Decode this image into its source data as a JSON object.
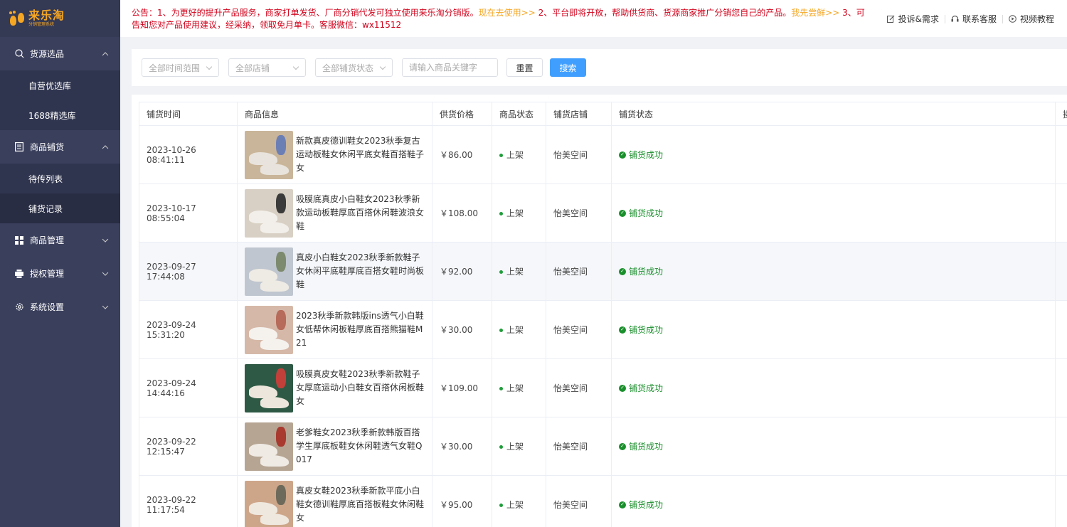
{
  "logo": {
    "title": "来乐淘",
    "subtitle": "分销管理系统",
    "brand_color": "#f5a623"
  },
  "sidebar": {
    "groups": [
      {
        "icon": "search-icon",
        "label": "货源选品",
        "expanded": true,
        "items": [
          "自营优选库",
          "1688精选库"
        ]
      },
      {
        "icon": "list-doc-icon",
        "label": "商品铺货",
        "expanded": true,
        "items": [
          "待传列表",
          "铺货记录"
        ],
        "active_item": "铺货记录"
      },
      {
        "icon": "grid-icon",
        "label": "商品管理",
        "expanded": false
      },
      {
        "icon": "printer-icon",
        "label": "授权管理",
        "expanded": false
      },
      {
        "icon": "gear-icon",
        "label": "系统设置",
        "expanded": false
      }
    ]
  },
  "notice": {
    "part1": "公告：1、为更好的提升产品服务，商家打单发货、厂商分销代发可独立使用来乐淘分销版。",
    "link1": "现在去使用>>",
    "part2": " 2、平台即将开放，帮助供货商、货源商家推广分销您自己的产品。",
    "link2": "我先尝鲜>>",
    "part3": " 3、可告知您对产品使用建议，经采纳，领取免月单卡。客服微信：wx11512"
  },
  "top_links": [
    "投诉&需求",
    "联系客服",
    "视频教程"
  ],
  "filters": {
    "time_range": "全部时间范围",
    "shop": "全部店铺",
    "status": "全部铺货状态",
    "keyword_placeholder": "请输入商品关键字",
    "reset": "重置",
    "search": "搜索"
  },
  "table": {
    "headers": [
      "铺货时间",
      "商品信息",
      "供货价格",
      "商品状态",
      "铺货店铺",
      "铺货状态",
      "操"
    ],
    "rows": [
      {
        "time": "2023-10-26 08:41:11",
        "name": "新款真皮德训鞋女2023秋季复古运动板鞋女休闲平底女鞋百搭鞋子女",
        "price": "￥86.00",
        "status": "上架",
        "shop": "怡美空间",
        "result": "铺货成功"
      },
      {
        "time": "2023-10-17 08:55:04",
        "name": "吸膜底真皮小白鞋女2023秋季新款运动板鞋厚底百搭休闲鞋波浪女鞋",
        "price": "￥108.00",
        "status": "上架",
        "shop": "怡美空间",
        "result": "铺货成功"
      },
      {
        "time": "2023-09-27 17:44:08",
        "name": "真皮小白鞋女2023秋季新款鞋子女休闲平底鞋厚底百搭女鞋时尚板鞋",
        "price": "￥92.00",
        "status": "上架",
        "shop": "怡美空间",
        "result": "铺货成功"
      },
      {
        "time": "2023-09-24 15:31:20",
        "name": "2023秋季新款韩版ins透气小白鞋女低帮休闲板鞋厚底百搭熊猫鞋M21",
        "price": "￥30.00",
        "status": "上架",
        "shop": "怡美空间",
        "result": "铺货成功"
      },
      {
        "time": "2023-09-24 14:44:16",
        "name": "吸膜真皮女鞋2023秋季新款鞋子女厚底运动小白鞋女百搭休闲板鞋女",
        "price": "￥109.00",
        "status": "上架",
        "shop": "怡美空间",
        "result": "铺货成功"
      },
      {
        "time": "2023-09-22 12:15:47",
        "name": "老爹鞋女2023秋季新款韩版百搭学生厚底板鞋女休闲鞋透气女鞋Q017",
        "price": "￥30.00",
        "status": "上架",
        "shop": "怡美空间",
        "result": "铺货成功"
      },
      {
        "time": "2023-09-22 11:17:54",
        "name": "真皮女鞋2023秋季新款平底小白鞋女德训鞋厚底百搭板鞋女休闲鞋女",
        "price": "￥95.00",
        "status": "上架",
        "shop": "怡美空间",
        "result": "铺货成功"
      }
    ]
  }
}
